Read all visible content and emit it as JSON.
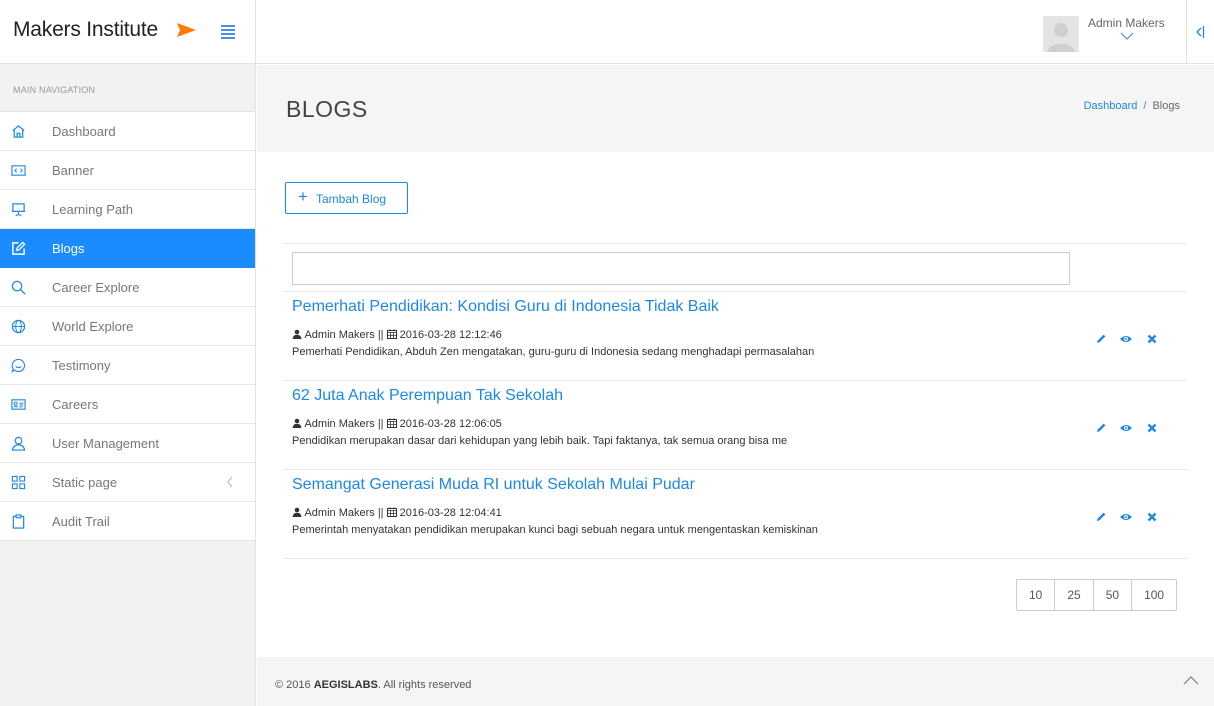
{
  "brand": {
    "name": "Makers Institute"
  },
  "header": {
    "user_name": "Admin Makers"
  },
  "sidebar": {
    "heading": "MAIN NAVIGATION",
    "items": [
      {
        "label": "Dashboard",
        "icon": "home-icon"
      },
      {
        "label": "Banner",
        "icon": "code-icon"
      },
      {
        "label": "Learning Path",
        "icon": "presentation-icon"
      },
      {
        "label": "Blogs",
        "icon": "edit-icon",
        "active": true
      },
      {
        "label": "Career Explore",
        "icon": "search-icon"
      },
      {
        "label": "World Explore",
        "icon": "globe-icon"
      },
      {
        "label": "Testimony",
        "icon": "chat-icon"
      },
      {
        "label": "Careers",
        "icon": "id-card-icon"
      },
      {
        "label": "User Management",
        "icon": "user-icon"
      },
      {
        "label": "Static page",
        "icon": "grid-icon"
      },
      {
        "label": "Audit Trail",
        "icon": "clipboard-icon"
      }
    ]
  },
  "page": {
    "title": "BLOGS",
    "breadcrumb": {
      "home": "Dashboard",
      "sep": "/",
      "current": "Blogs"
    }
  },
  "toolbar": {
    "add_label": "Tambah Blog"
  },
  "search": {
    "value": "",
    "placeholder": ""
  },
  "blogs": [
    {
      "title": "Pemerhati Pendidikan: Kondisi Guru di Indonesia Tidak Baik",
      "author": "Admin Makers",
      "separator": "||",
      "date": "2016-03-28 12:12:46",
      "excerpt": "Pemerhati Pendidikan, Abduh Zen mengatakan, guru-guru di Indonesia sedang menghadapi permasalahan"
    },
    {
      "title": "62 Juta Anak Perempuan Tak Sekolah",
      "author": "Admin Makers",
      "separator": "||",
      "date": "2016-03-28 12:06:05",
      "excerpt": "Pendidikan merupakan dasar dari kehidupan yang lebih baik. Tapi faktanya, tak semua orang bisa me"
    },
    {
      "title": "Semangat Generasi Muda RI untuk Sekolah Mulai Pudar",
      "author": "Admin Makers",
      "separator": "||",
      "date": "2016-03-28 12:04:41",
      "excerpt": "Pemerintah menyatakan pendidikan merupakan kunci bagi sebuah negara untuk mengentaskan kemiskinan"
    }
  ],
  "pagination": {
    "page_sizes": [
      "10",
      "25",
      "50",
      "100"
    ]
  },
  "footer": {
    "copyright": "© 2016",
    "company": "AEGISLABS",
    "rights": ". All rights reserved"
  },
  "colors": {
    "accent": "#1a8cff",
    "brand_arrow": "#ff7a00",
    "link": "#1e88e5"
  }
}
